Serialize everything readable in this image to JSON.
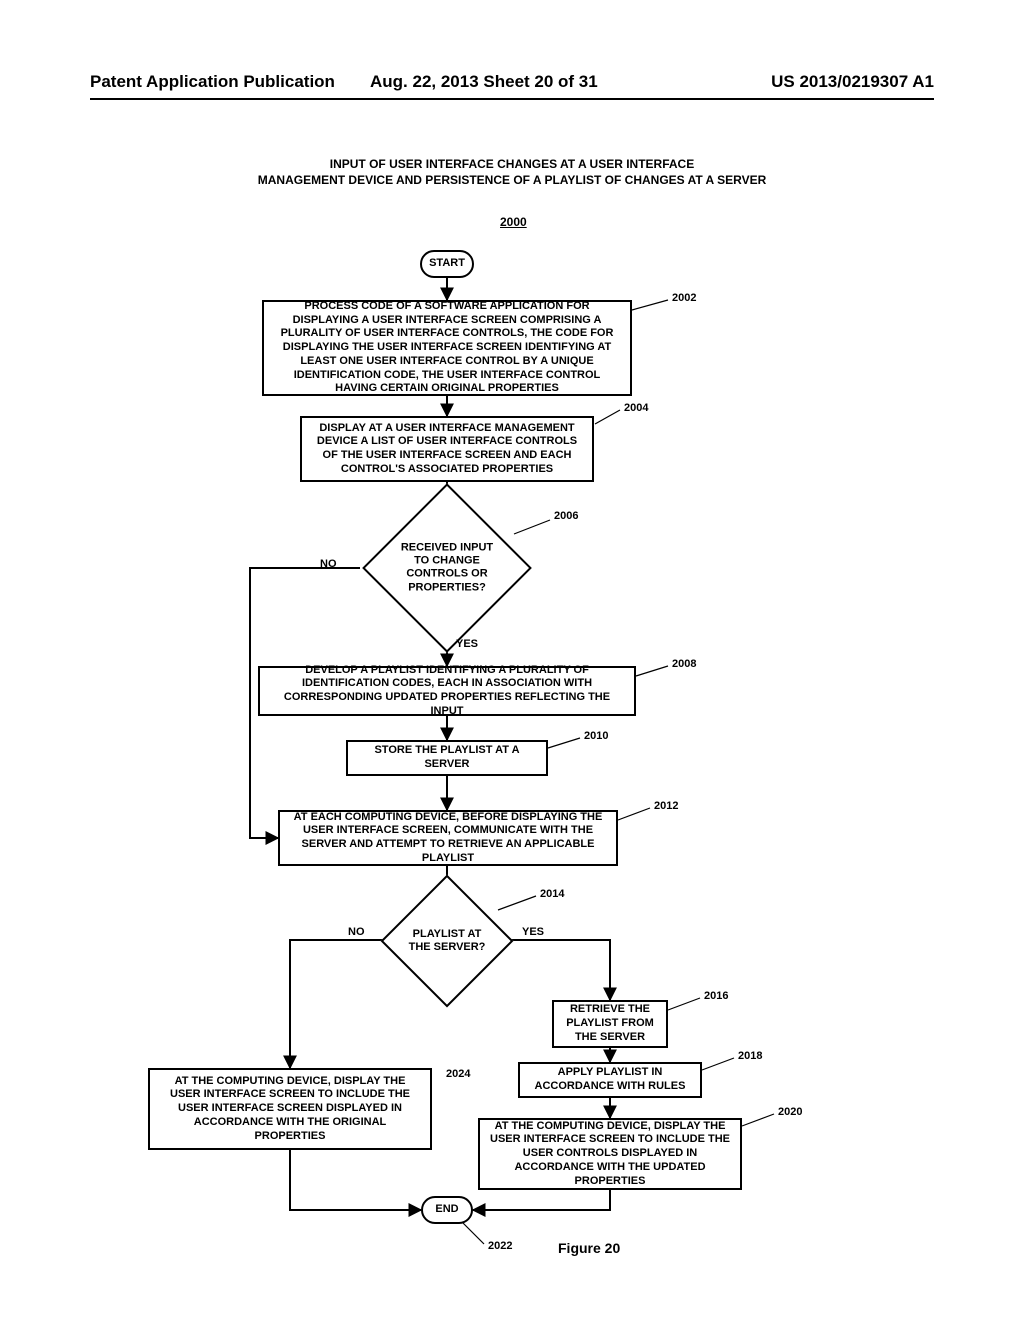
{
  "header": {
    "left": "Patent Application Publication",
    "mid": "Aug. 22, 2013  Sheet 20 of 31",
    "right": "US 2013/0219307 A1"
  },
  "title": "INPUT OF USER INTERFACE CHANGES AT A USER INTERFACE\nMANAGEMENT DEVICE AND PERSISTENCE OF A PLAYLIST OF CHANGES AT A SERVER",
  "flow_number": "2000",
  "figure_label": "Figure 20",
  "nodes": {
    "start": "START",
    "end": "END",
    "b2002": "PROCESS CODE OF A SOFTWARE APPLICATION FOR DISPLAYING A USER INTERFACE SCREEN COMPRISING A PLURALITY OF USER INTERFACE CONTROLS, THE CODE FOR DISPLAYING THE USER INTERFACE SCREEN IDENTIFYING AT LEAST ONE USER INTERFACE CONTROL BY A UNIQUE IDENTIFICATION CODE, THE USER INTERFACE CONTROL HAVING CERTAIN ORIGINAL PROPERTIES",
    "b2004": "DISPLAY AT A USER INTERFACE MANAGEMENT DEVICE A LIST OF USER INTERFACE CONTROLS OF THE USER INTERFACE SCREEN AND EACH CONTROL'S ASSOCIATED PROPERTIES",
    "d2006": "RECEIVED INPUT TO CHANGE CONTROLS OR PROPERTIES?",
    "b2008": "DEVELOP A PLAYLIST IDENTIFYING A PLURALITY OF IDENTIFICATION CODES, EACH IN ASSOCIATION WITH CORRESPONDING UPDATED PROPERTIES REFLECTING THE INPUT",
    "b2010": "STORE THE PLAYLIST AT A SERVER",
    "b2012": "AT EACH COMPUTING DEVICE, BEFORE DISPLAYING THE USER INTERFACE SCREEN, COMMUNICATE WITH THE SERVER AND ATTEMPT TO RETRIEVE AN APPLICABLE PLAYLIST",
    "d2014": "PLAYLIST AT THE SERVER?",
    "b2016": "RETRIEVE THE PLAYLIST FROM THE SERVER",
    "b2018": "APPLY PLAYLIST IN ACCORDANCE WITH RULES",
    "b2020": "AT THE COMPUTING DEVICE, DISPLAY THE USER INTERFACE SCREEN TO INCLUDE THE USER CONTROLS DISPLAYED IN ACCORDANCE WITH THE UPDATED PROPERTIES",
    "b2024": "AT THE COMPUTING DEVICE, DISPLAY THE USER INTERFACE SCREEN TO INCLUDE THE USER INTERFACE SCREEN DISPLAYED IN ACCORDANCE WITH THE ORIGINAL PROPERTIES"
  },
  "labels": {
    "no": "NO",
    "yes": "YES"
  },
  "refs": {
    "r2002": "2002",
    "r2004": "2004",
    "r2006": "2006",
    "r2008": "2008",
    "r2010": "2010",
    "r2012": "2012",
    "r2014": "2014",
    "r2016": "2016",
    "r2018": "2018",
    "r2020": "2020",
    "r2022": "2022",
    "r2024": "2024"
  },
  "chart_data": {
    "type": "flowchart",
    "title": "INPUT OF USER INTERFACE CHANGES AT A USER INTERFACE MANAGEMENT DEVICE AND PERSISTENCE OF A PLAYLIST OF CHANGES AT A SERVER",
    "id": "2000",
    "nodes": [
      {
        "id": "start",
        "type": "terminator",
        "label": "START"
      },
      {
        "id": "2002",
        "type": "process",
        "label": "PROCESS CODE OF A SOFTWARE APPLICATION FOR DISPLAYING A USER INTERFACE SCREEN COMPRISING A PLURALITY OF USER INTERFACE CONTROLS, THE CODE FOR DISPLAYING THE USER INTERFACE SCREEN IDENTIFYING AT LEAST ONE USER INTERFACE CONTROL BY A UNIQUE IDENTIFICATION CODE, THE USER INTERFACE CONTROL HAVING CERTAIN ORIGINAL PROPERTIES"
      },
      {
        "id": "2004",
        "type": "process",
        "label": "DISPLAY AT A USER INTERFACE MANAGEMENT DEVICE A LIST OF USER INTERFACE CONTROLS OF THE USER INTERFACE SCREEN AND EACH CONTROL'S ASSOCIATED PROPERTIES"
      },
      {
        "id": "2006",
        "type": "decision",
        "label": "RECEIVED INPUT TO CHANGE CONTROLS OR PROPERTIES?"
      },
      {
        "id": "2008",
        "type": "process",
        "label": "DEVELOP A PLAYLIST IDENTIFYING A PLURALITY OF IDENTIFICATION CODES, EACH IN ASSOCIATION WITH CORRESPONDING UPDATED PROPERTIES REFLECTING THE INPUT"
      },
      {
        "id": "2010",
        "type": "process",
        "label": "STORE THE PLAYLIST AT A SERVER"
      },
      {
        "id": "2012",
        "type": "process",
        "label": "AT EACH COMPUTING DEVICE, BEFORE DISPLAYING THE USER INTERFACE SCREEN, COMMUNICATE WITH THE SERVER AND ATTEMPT TO RETRIEVE AN APPLICABLE PLAYLIST"
      },
      {
        "id": "2014",
        "type": "decision",
        "label": "PLAYLIST AT THE SERVER?"
      },
      {
        "id": "2016",
        "type": "process",
        "label": "RETRIEVE THE PLAYLIST FROM THE SERVER"
      },
      {
        "id": "2018",
        "type": "process",
        "label": "APPLY PLAYLIST IN ACCORDANCE WITH RULES"
      },
      {
        "id": "2020",
        "type": "process",
        "label": "AT THE COMPUTING DEVICE, DISPLAY THE USER INTERFACE SCREEN TO INCLUDE THE USER CONTROLS DISPLAYED IN ACCORDANCE WITH THE UPDATED PROPERTIES"
      },
      {
        "id": "2024",
        "type": "process",
        "label": "AT THE COMPUTING DEVICE, DISPLAY THE USER INTERFACE SCREEN TO INCLUDE THE USER INTERFACE SCREEN DISPLAYED IN ACCORDANCE WITH THE ORIGINAL PROPERTIES"
      },
      {
        "id": "end",
        "type": "terminator",
        "label": "END",
        "ref": "2022"
      }
    ],
    "edges": [
      {
        "from": "start",
        "to": "2002"
      },
      {
        "from": "2002",
        "to": "2004"
      },
      {
        "from": "2004",
        "to": "2006"
      },
      {
        "from": "2006",
        "to": "2012",
        "label": "NO"
      },
      {
        "from": "2006",
        "to": "2008",
        "label": "YES"
      },
      {
        "from": "2008",
        "to": "2010"
      },
      {
        "from": "2010",
        "to": "2012"
      },
      {
        "from": "2012",
        "to": "2014"
      },
      {
        "from": "2014",
        "to": "2024",
        "label": "NO"
      },
      {
        "from": "2014",
        "to": "2016",
        "label": "YES"
      },
      {
        "from": "2016",
        "to": "2018"
      },
      {
        "from": "2018",
        "to": "2020"
      },
      {
        "from": "2020",
        "to": "end"
      },
      {
        "from": "2024",
        "to": "end"
      }
    ]
  }
}
